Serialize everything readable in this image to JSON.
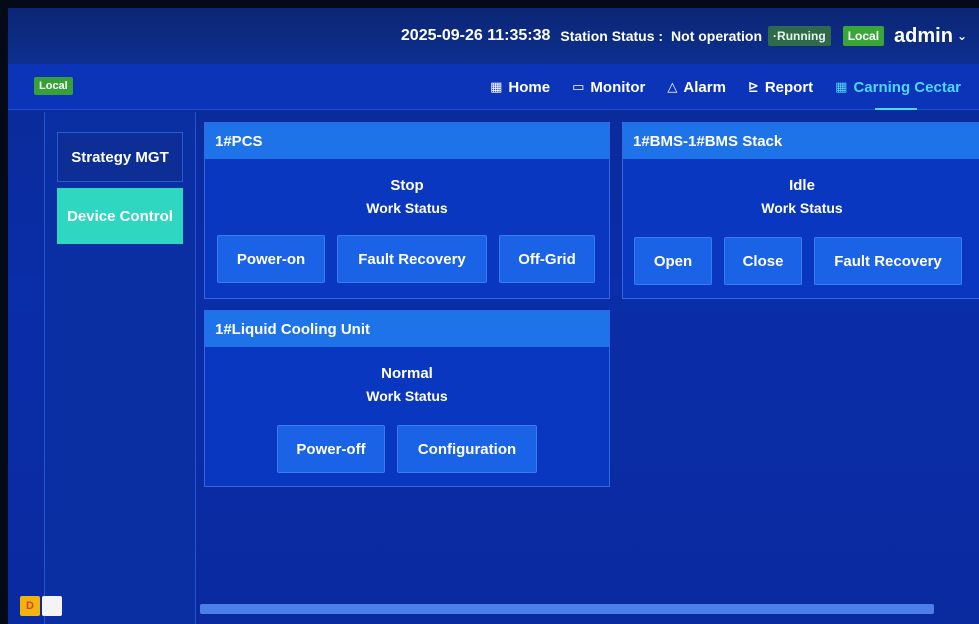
{
  "topbar": {
    "datetime": "2025-09-26 11:35:38",
    "station_status_label": "Station Status :",
    "station_status_value": "Not operation",
    "running_badge": "·Running",
    "local_badge": "Local",
    "user": "admin",
    "user_caret": "⌄"
  },
  "navbar": {
    "local_tag": "Local",
    "items": [
      {
        "icon": "▦",
        "label": "Home"
      },
      {
        "icon": "▭",
        "label": "Monitor"
      },
      {
        "icon": "△",
        "label": "Alarm"
      },
      {
        "icon": "⊵",
        "label": "Report"
      },
      {
        "icon": "▦",
        "label": "Carning Cectar"
      }
    ]
  },
  "sidebar": {
    "items": [
      {
        "label": "Strategy MGT"
      },
      {
        "label": "Device Control"
      }
    ]
  },
  "panels": {
    "pcs": {
      "title": "1#PCS",
      "status": "Stop",
      "status_label": "Work Status",
      "buttons": [
        "Power-on",
        "Fault Recovery",
        "Off-Grid"
      ]
    },
    "bms": {
      "title": "1#BMS-1#BMS Stack",
      "status": "Idle",
      "status_label": "Work Status",
      "buttons": [
        "Open",
        "Close",
        "Fault Recovery"
      ]
    },
    "lcu": {
      "title": "1#Liquid Cooling Unit",
      "status": "Normal",
      "status_label": "Work Status",
      "buttons": [
        "Power-off",
        "Configuration"
      ]
    }
  },
  "taskbar": {
    "app_icon_letter": "D"
  },
  "colors": {
    "accent": "#4fd6ff",
    "active_side": "#2fd6c0",
    "panel_head": "#1f73e8",
    "button": "#1a63e6",
    "local_green": "#36a136"
  }
}
